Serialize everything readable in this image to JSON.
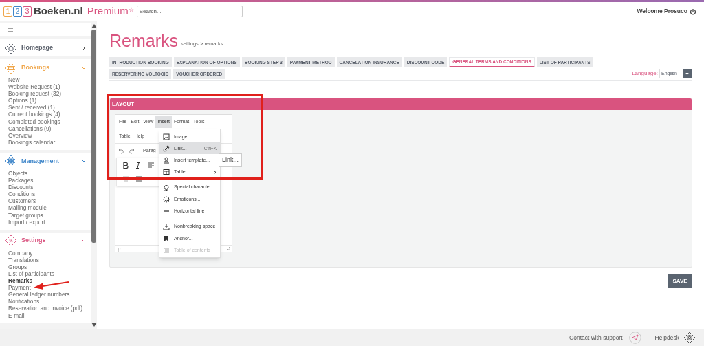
{
  "header": {
    "logo_digits": [
      "1",
      "2",
      "3"
    ],
    "logo_text": "Boeken.nl",
    "edition": "Premium",
    "edition_mark": "☆",
    "search": {
      "placeholder": "Search..."
    },
    "welcome": "Welcome Prosuco"
  },
  "sidebar": {
    "sections": [
      {
        "title": "Homepage",
        "kind": "home",
        "color": "#555b66",
        "expanded": false
      },
      {
        "title": "Bookings",
        "kind": "bookings",
        "color": "#f0a64a",
        "expanded": true,
        "items": [
          {
            "label": "New",
            "selected": false
          },
          {
            "label": "Website Request (1)",
            "selected": false
          },
          {
            "label": "Booking request (32)",
            "selected": false
          },
          {
            "label": "Options (1)",
            "selected": false
          },
          {
            "label": "Sent / received (1)",
            "selected": false
          },
          {
            "label": "Current bookings (4)",
            "selected": false
          },
          {
            "label": "Completed bookings",
            "selected": false
          },
          {
            "label": "Cancellations (9)",
            "selected": false
          },
          {
            "label": "Overview",
            "selected": false
          },
          {
            "label": "Bookings calendar",
            "selected": false
          }
        ]
      },
      {
        "title": "Management",
        "kind": "management",
        "color": "#3f86c9",
        "expanded": true,
        "items": [
          {
            "label": "Objects",
            "selected": false
          },
          {
            "label": "Packages",
            "selected": false
          },
          {
            "label": "Discounts",
            "selected": false
          },
          {
            "label": "Conditions",
            "selected": false
          },
          {
            "label": "Customers",
            "selected": false
          },
          {
            "label": "Mailing module",
            "selected": false
          },
          {
            "label": "Target groups",
            "selected": false
          },
          {
            "label": "Import / export",
            "selected": false
          }
        ]
      },
      {
        "title": "Settings",
        "kind": "settings",
        "color": "#d9537f",
        "expanded": true,
        "items": [
          {
            "label": "Company",
            "selected": false
          },
          {
            "label": "Translations",
            "selected": false
          },
          {
            "label": "Groups",
            "selected": false
          },
          {
            "label": "List of participants",
            "selected": false
          },
          {
            "label": "Remarks",
            "selected": true
          },
          {
            "label": "Payment",
            "selected": false
          },
          {
            "label": "General ledger numbers",
            "selected": false
          },
          {
            "label": "Notifications",
            "selected": false
          },
          {
            "label": "Reservation and invoice (pdf)",
            "selected": false
          },
          {
            "label": "E-mail",
            "selected": false
          }
        ]
      }
    ]
  },
  "page": {
    "title": "Remarks",
    "breadcrumb": "settings > remarks"
  },
  "tabs": [
    {
      "label": "INTRODUCTION BOOKING",
      "selected": false
    },
    {
      "label": "EXPLANATION OF OPTIONS",
      "selected": false
    },
    {
      "label": "BOOKING STEP 3",
      "selected": false
    },
    {
      "label": "PAYMENT METHOD",
      "selected": false
    },
    {
      "label": "CANCELATION INSURANCE",
      "selected": false
    },
    {
      "label": "DISCOUNT CODE",
      "selected": false
    },
    {
      "label": "GENERAL TERMS AND CONDITIONS",
      "selected": true
    },
    {
      "label": "LIST OF PARTICIPANTS",
      "selected": false
    },
    {
      "label": "RESERVERING VOLTOOID",
      "selected": false
    },
    {
      "label": "VOUCHER ORDERED",
      "selected": false
    }
  ],
  "language": {
    "label": "Language:",
    "value": "English"
  },
  "panel": {
    "title": "LAYOUT"
  },
  "editor": {
    "menubar": [
      {
        "label": "File",
        "selected": false
      },
      {
        "label": "Edit",
        "selected": false
      },
      {
        "label": "View",
        "selected": false
      },
      {
        "label": "Insert",
        "selected": true
      },
      {
        "label": "Format",
        "selected": false
      },
      {
        "label": "Tools",
        "selected": false
      }
    ],
    "menubar_row2": [
      {
        "label": "Table",
        "selected": false
      },
      {
        "label": "Help",
        "selected": false
      }
    ],
    "block_format": "Parag",
    "status_path": "p",
    "menu": [
      {
        "label": "Image...",
        "kind": "image",
        "highlighted": false,
        "disabled": false,
        "separator_before": false
      },
      {
        "label": "Link...",
        "kind": "link",
        "shortcut": "Ctrl+K",
        "highlighted": true,
        "disabled": false,
        "separator_before": false
      },
      {
        "label": "Insert template...",
        "kind": "template",
        "highlighted": false,
        "disabled": false,
        "separator_before": false
      },
      {
        "label": "Table",
        "kind": "table",
        "submenu": true,
        "highlighted": false,
        "disabled": false,
        "separator_before": false
      },
      {
        "label": "Special character...",
        "kind": "omega",
        "highlighted": false,
        "disabled": false,
        "separator_before": true
      },
      {
        "label": "Emoticons...",
        "kind": "emoticon",
        "highlighted": false,
        "disabled": false,
        "separator_before": false
      },
      {
        "label": "Horizontal line",
        "kind": "hr",
        "highlighted": false,
        "disabled": false,
        "separator_before": false
      },
      {
        "label": "Nonbreaking space",
        "kind": "nbsp",
        "highlighted": false,
        "disabled": false,
        "separator_before": true
      },
      {
        "label": "Anchor...",
        "kind": "anchor",
        "highlighted": false,
        "disabled": false,
        "separator_before": false
      },
      {
        "label": "Table of contents",
        "kind": "toc",
        "highlighted": false,
        "disabled": true,
        "separator_before": false
      }
    ],
    "tooltip": "Link..."
  },
  "save_button": "SAVE",
  "footer": {
    "support": "Contact with support",
    "helpdesk": "Helpdesk"
  },
  "annotations": [
    {
      "kind": "rectangle"
    },
    {
      "kind": "arrow"
    }
  ]
}
